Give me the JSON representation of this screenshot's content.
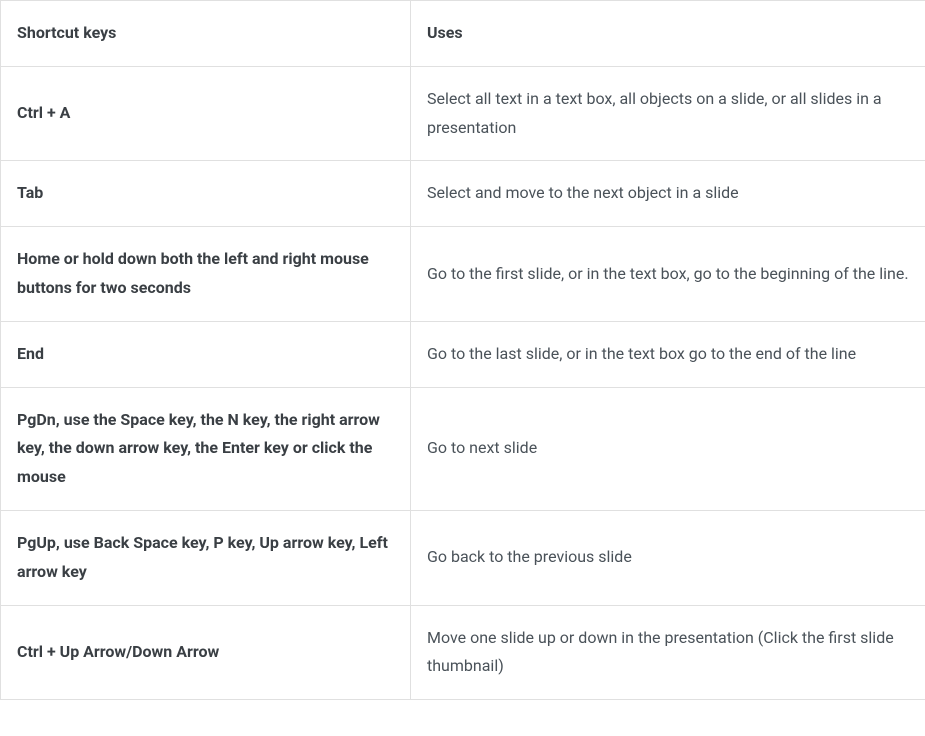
{
  "table": {
    "headers": {
      "shortcut": "Shortcut keys",
      "uses": "Uses"
    },
    "rows": [
      {
        "shortcut": "Ctrl + A",
        "uses": "Select all text in a text box, all objects on a slide, or all slides in a presentation"
      },
      {
        "shortcut": "Tab",
        "uses": "Select and move to the next object in a slide"
      },
      {
        "shortcut": "Home or hold down both the left and right mouse buttons for two seconds",
        "uses": "Go to the first slide, or in the text box, go to the beginning of the line."
      },
      {
        "shortcut": "End",
        "uses": "Go to the last slide, or in the text box go to the end of the line"
      },
      {
        "shortcut": "PgDn, use the Space key, the N key, the right arrow key, the down arrow key, the Enter key or click the mouse",
        "uses": "Go to next slide"
      },
      {
        "shortcut": "PgUp, use Back Space key, P key, Up arrow key, Left arrow key",
        "uses": "Go back to the previous slide"
      },
      {
        "shortcut": "Ctrl + Up Arrow/Down Arrow",
        "uses": "Move one slide up or down in the presentation (Click the first slide thumbnail)"
      }
    ]
  }
}
